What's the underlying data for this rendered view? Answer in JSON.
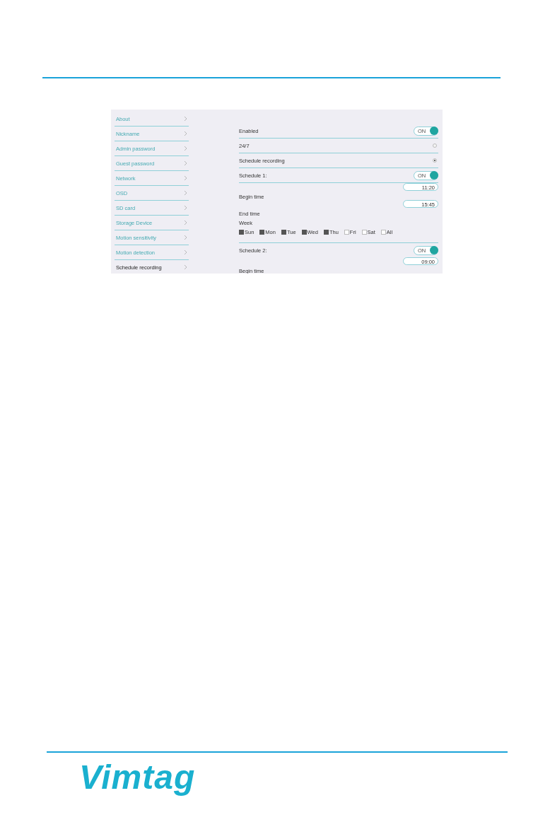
{
  "sidebar": {
    "items": [
      {
        "label": "About",
        "selected": false
      },
      {
        "label": "Nickname",
        "selected": false
      },
      {
        "label": "Admin password",
        "selected": false
      },
      {
        "label": "Guest password",
        "selected": false
      },
      {
        "label": "Network",
        "selected": false
      },
      {
        "label": "OSD",
        "selected": false
      },
      {
        "label": "SD card",
        "selected": false
      },
      {
        "label": "Storage Device",
        "selected": false
      },
      {
        "label": "Motion sensitivity",
        "selected": false
      },
      {
        "label": "Motion detection",
        "selected": false
      },
      {
        "label": "Schedule recording",
        "selected": true
      }
    ]
  },
  "settings": {
    "enabled": {
      "label": "Enabled",
      "toggle": "ON",
      "on": true
    },
    "modes": [
      {
        "label": "24/7",
        "selected": false
      },
      {
        "label": "Schedule recording",
        "selected": true
      }
    ],
    "schedules": [
      {
        "label": "Schedule 1:",
        "toggle": "ON",
        "on": true,
        "begin": {
          "label": "Begin time",
          "value": "11:20"
        },
        "end": {
          "label": "End time",
          "value": "15:45"
        },
        "week": {
          "label": "Week",
          "days": [
            {
              "label": "Sun",
              "checked": true
            },
            {
              "label": "Mon",
              "checked": true
            },
            {
              "label": "Tue",
              "checked": true
            },
            {
              "label": "Wed",
              "checked": true
            },
            {
              "label": "Thu",
              "checked": true
            },
            {
              "label": "Fri",
              "checked": false
            },
            {
              "label": "Sat",
              "checked": false
            },
            {
              "label": "All",
              "checked": false
            }
          ]
        }
      },
      {
        "label": "Schedule 2:",
        "toggle": "ON",
        "on": true,
        "begin": {
          "label": "Begin time",
          "value": "09:00"
        }
      }
    ]
  },
  "footer": {
    "logo": "Vimtag"
  }
}
